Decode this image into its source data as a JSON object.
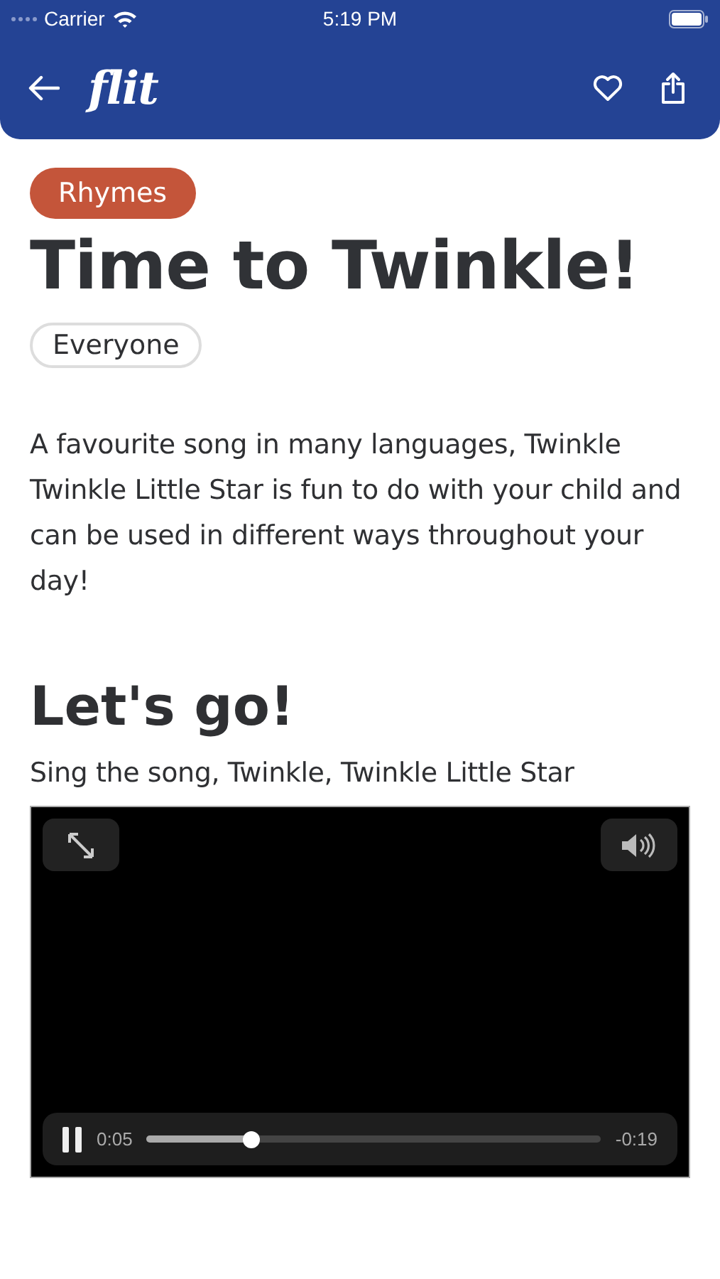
{
  "status_bar": {
    "carrier": "Carrier",
    "time": "5:19 PM"
  },
  "header": {
    "logo": "flit"
  },
  "category": "Rhymes",
  "title": "Time to Twinkle!",
  "audience": "Everyone",
  "description": "A favourite song in many languages, Twinkle Twinkle Little Star is fun to do with your child and can be used in different ways throughout your day!",
  "sections": [
    {
      "heading": "Let's go!",
      "text": "Sing the song, Twinkle, Twinkle Little Star",
      "video": {
        "elapsed": "0:05",
        "remaining": "-0:19",
        "level": 0.23,
        "playing": true
      }
    }
  ]
}
